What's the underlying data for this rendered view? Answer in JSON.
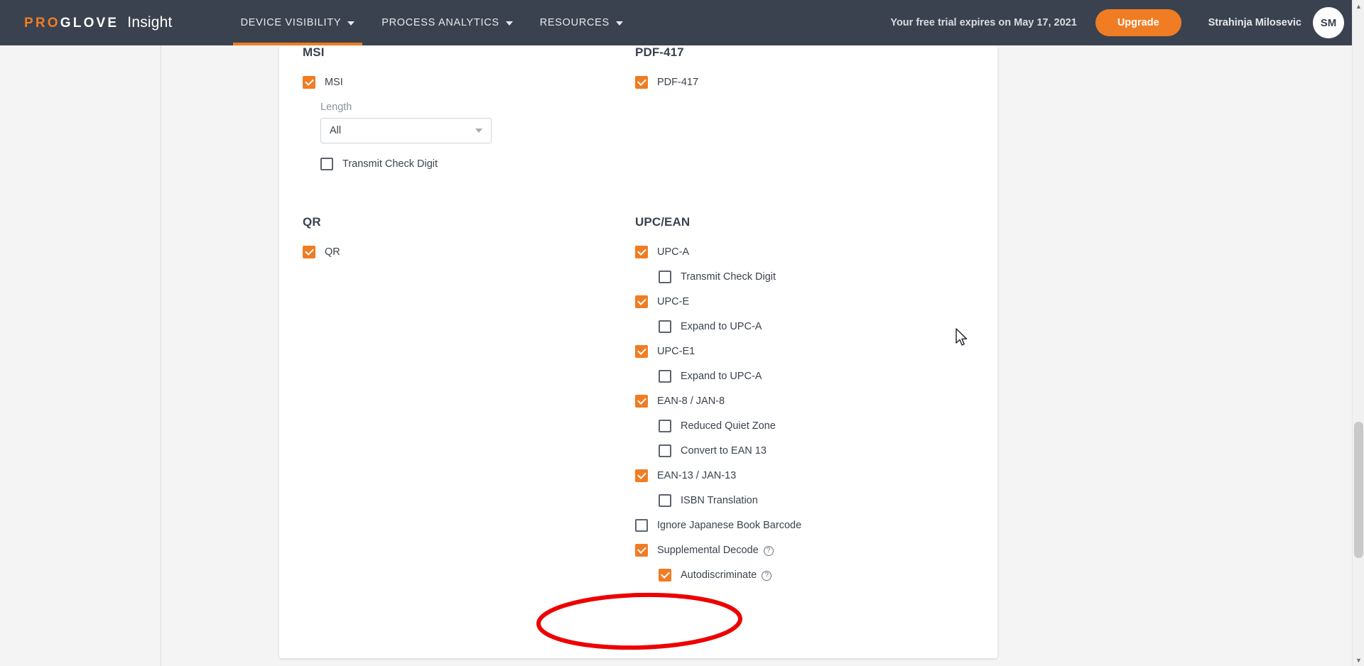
{
  "header": {
    "brand_pro": "PRO",
    "brand_glove": "GLOVE",
    "product": "Insight",
    "nav": [
      {
        "label": "DEVICE VISIBILITY",
        "active": true
      },
      {
        "label": "PROCESS ANALYTICS",
        "active": false
      },
      {
        "label": "RESOURCES",
        "active": false
      }
    ],
    "trial_notice": "Your free trial expires on May 17, 2021",
    "upgrade_label": "Upgrade",
    "user_name": "Strahinja Milosevic",
    "user_initials": "SM",
    "bar_color": "#3b424f",
    "accent_color": "#f07d23"
  },
  "groups": {
    "msi": {
      "title": "MSI",
      "enable": {
        "label": "MSI",
        "checked": true
      },
      "length_label": "Length",
      "length_value": "All",
      "transmit_check_digit": {
        "label": "Transmit Check Digit",
        "checked": false
      }
    },
    "pdf417": {
      "title": "PDF-417",
      "enable": {
        "label": "PDF-417",
        "checked": true
      }
    },
    "qr": {
      "title": "QR",
      "enable": {
        "label": "QR",
        "checked": true
      }
    },
    "upcean": {
      "title": "UPC/EAN",
      "rows": [
        {
          "label": "UPC-A",
          "checked": true,
          "indent": false,
          "help": false
        },
        {
          "label": "Transmit Check Digit",
          "checked": false,
          "indent": true,
          "help": false
        },
        {
          "label": "UPC-E",
          "checked": true,
          "indent": false,
          "help": false
        },
        {
          "label": "Expand to UPC-A",
          "checked": false,
          "indent": true,
          "help": false
        },
        {
          "label": "UPC-E1",
          "checked": true,
          "indent": false,
          "help": false
        },
        {
          "label": "Expand to UPC-A",
          "checked": false,
          "indent": true,
          "help": false
        },
        {
          "label": "EAN-8 / JAN-8",
          "checked": true,
          "indent": false,
          "help": false
        },
        {
          "label": "Reduced Quiet Zone",
          "checked": false,
          "indent": true,
          "help": false
        },
        {
          "label": "Convert to EAN 13",
          "checked": false,
          "indent": true,
          "help": false
        },
        {
          "label": "EAN-13 / JAN-13",
          "checked": true,
          "indent": false,
          "help": false
        },
        {
          "label": "ISBN Translation",
          "checked": false,
          "indent": true,
          "help": false
        },
        {
          "label": "Ignore Japanese Book Barcode",
          "checked": false,
          "indent": false,
          "help": false
        },
        {
          "label": "Supplemental Decode",
          "checked": true,
          "indent": false,
          "help": true
        },
        {
          "label": "Autodiscriminate",
          "checked": true,
          "indent": true,
          "help": true
        }
      ]
    }
  },
  "annotation": {
    "shape": "ellipse",
    "color": "#ee0000",
    "encircles": "Supplemental Decode and Autodiscriminate options"
  },
  "help_glyph": "?",
  "scrollbar": {
    "up_arrow": "▲",
    "down_arrow": "▼"
  }
}
